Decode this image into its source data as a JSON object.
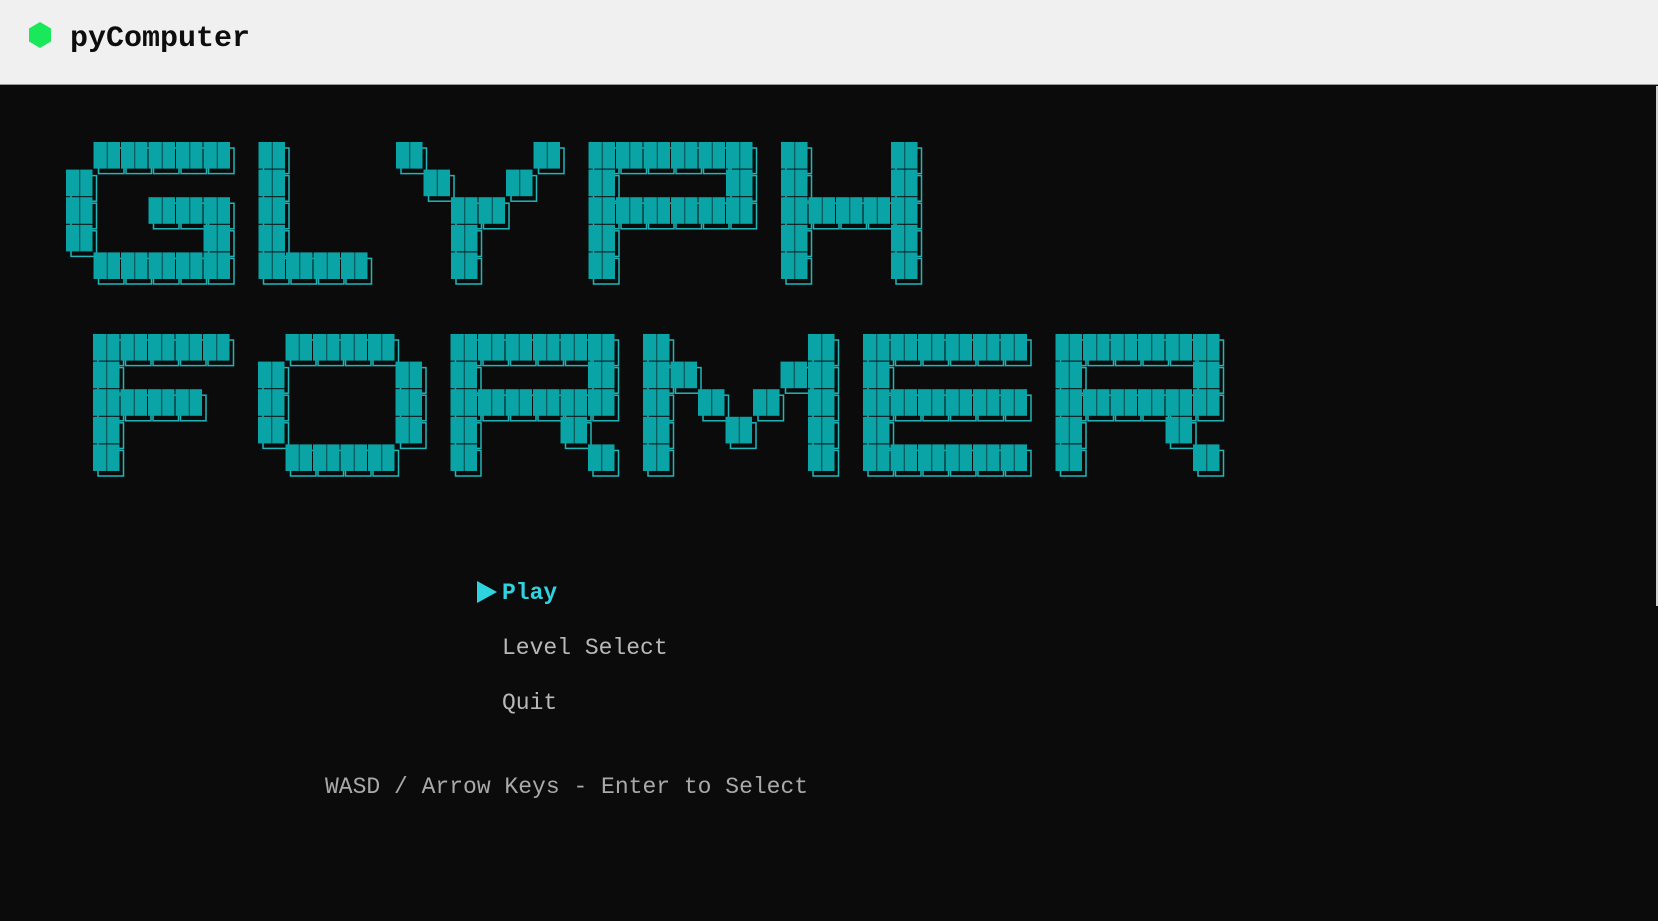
{
  "window": {
    "title": "pyComputer",
    "icon": "green-hexagon-icon"
  },
  "game": {
    "logo": {
      "lines": [
        "GLYPH",
        "FORMER"
      ],
      "color": "#0aa3a6",
      "outline_color": "#1fb6b9"
    },
    "menu": {
      "selected_index": 0,
      "cursor_icon": "play-triangle-icon",
      "items": [
        {
          "label": "Play"
        },
        {
          "label": "Level Select"
        },
        {
          "label": "Quit"
        }
      ]
    },
    "hint": "WASD / Arrow Keys - Enter to Select"
  },
  "colors": {
    "titlebar_bg": "#f0f0f0",
    "terminal_bg": "#0b0b0b",
    "accent": "#2fd3df",
    "menu_text": "#b8b8b8",
    "icon_green": "#18e85a"
  }
}
